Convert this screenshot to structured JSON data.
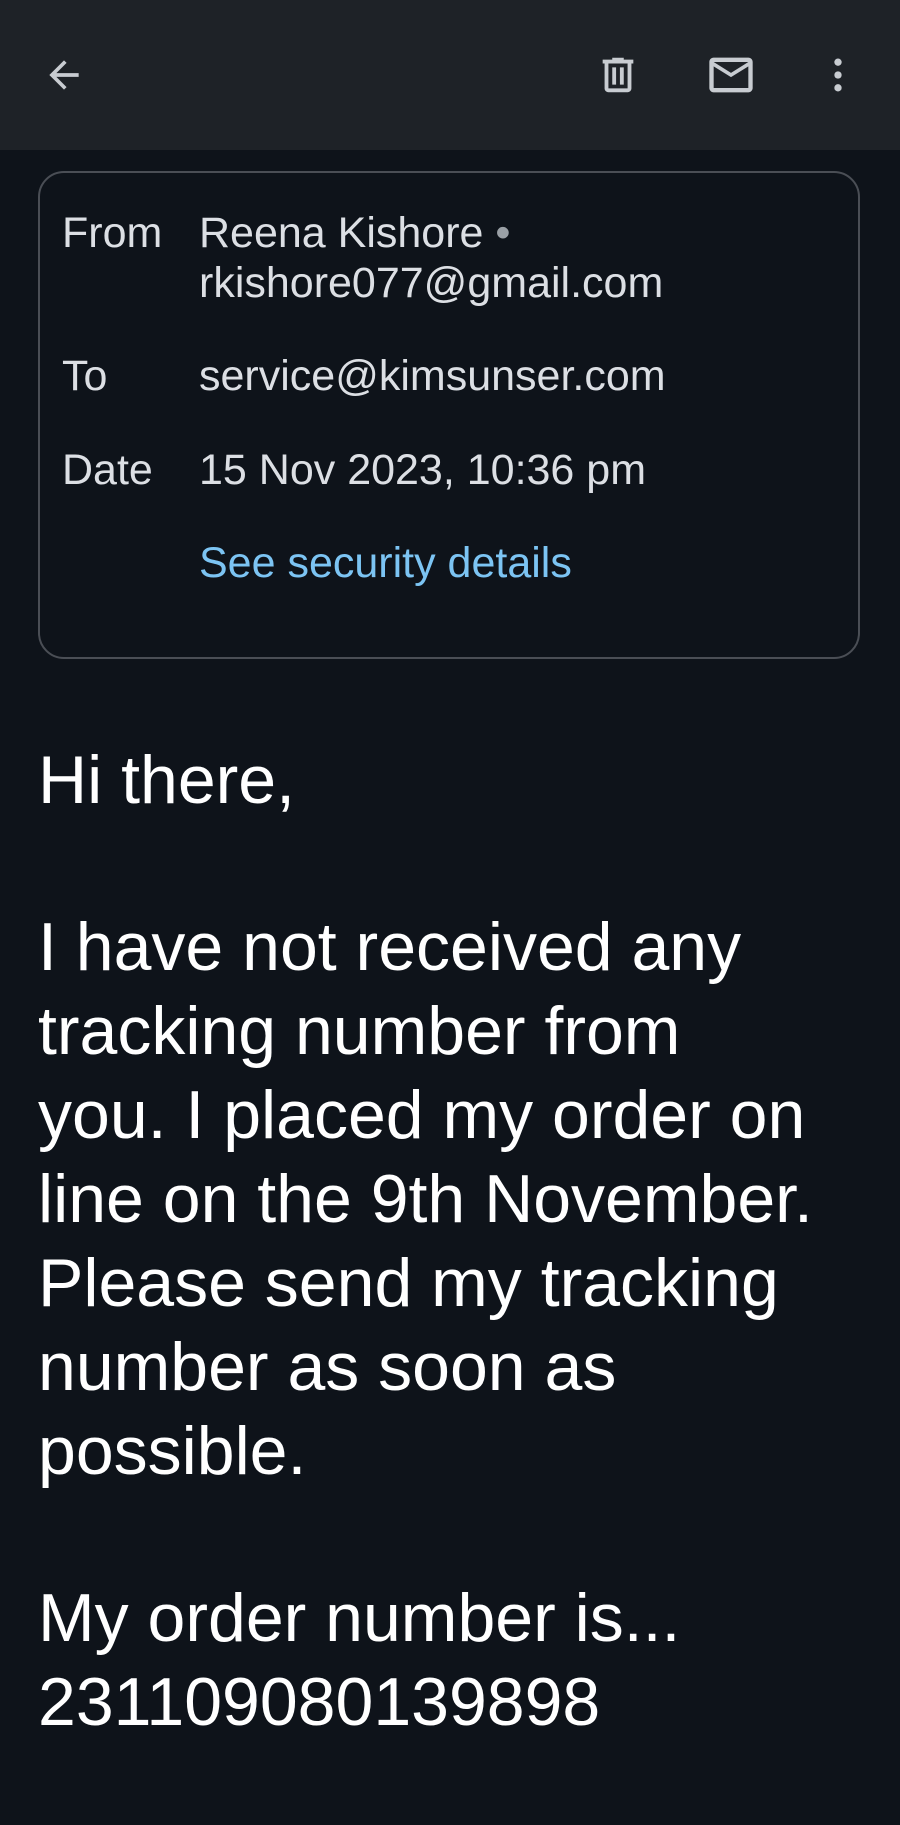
{
  "toolbar": {
    "back_icon": "arrow-left-icon",
    "delete_icon": "trash-icon",
    "mark_unread_icon": "envelope-icon",
    "more_icon": "more-vertical-icon"
  },
  "details": {
    "from_label": "From",
    "from_name": "Reena Kishore",
    "separator": "•",
    "from_email": "rkishore077@gmail.com",
    "to_label": "To",
    "to_value": "service@kimsunser.com",
    "date_label": "Date",
    "date_value": "15 Nov 2023, 10:36 pm",
    "security_link": "See security details"
  },
  "message": {
    "greeting": "Hi there,",
    "paragraph_lines": [
      "I have not received any",
      "tracking number from",
      "you. I placed my order on",
      "line on the 9th November.",
      "Please send my tracking",
      "number as soon as",
      "possible."
    ],
    "order_line": "My order number is...",
    "order_number": "231109080139898"
  },
  "colors": {
    "background": "#0e131a",
    "app_bar": "#1e2227",
    "card_border": "#4a4e55",
    "link": "#7cc4f3",
    "text": "#ffffff",
    "muted_text": "#dcdfe4"
  }
}
